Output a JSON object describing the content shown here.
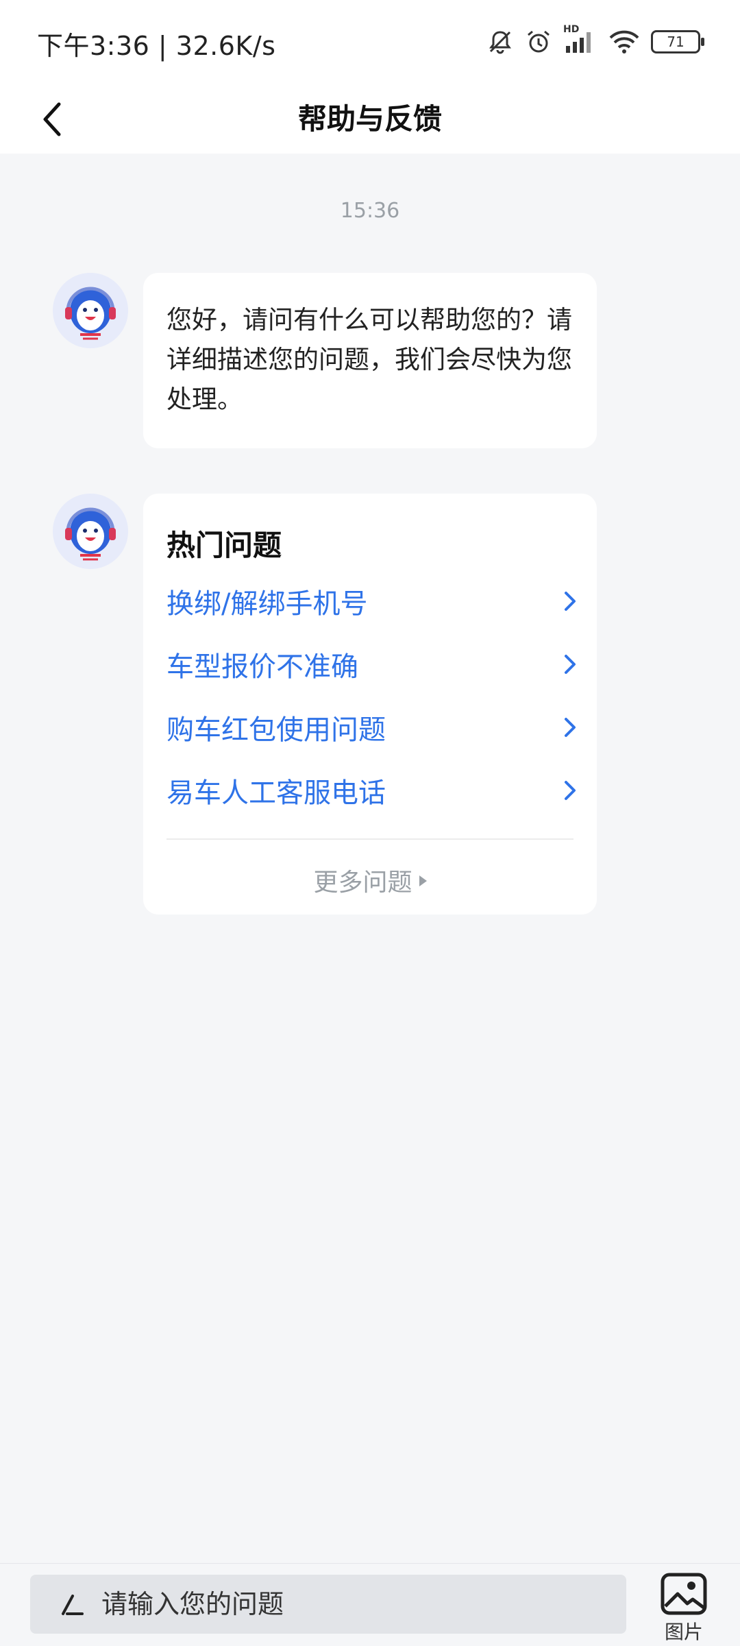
{
  "status": {
    "time_speed": "下午3:36 | 32.6K/s",
    "battery": "71",
    "network_badge": "HD"
  },
  "nav": {
    "title": "帮助与反馈"
  },
  "chat": {
    "timestamp": "15:36",
    "greeting": "您好，请问有什么可以帮助您的？请详细描述您的问题，我们会尽快为您处理。",
    "faq": {
      "title": "热门问题",
      "items": [
        {
          "label": "换绑/解绑手机号"
        },
        {
          "label": "车型报价不准确"
        },
        {
          "label": "购车红包使用问题"
        },
        {
          "label": "易车人工客服电话"
        }
      ],
      "more": "更多问题"
    }
  },
  "input": {
    "placeholder": "请输入您的问题"
  },
  "image_button": {
    "label": "图片"
  },
  "colors": {
    "link": "#2f73e8",
    "background": "#f5f6f8",
    "muted": "#9aa0a6"
  }
}
